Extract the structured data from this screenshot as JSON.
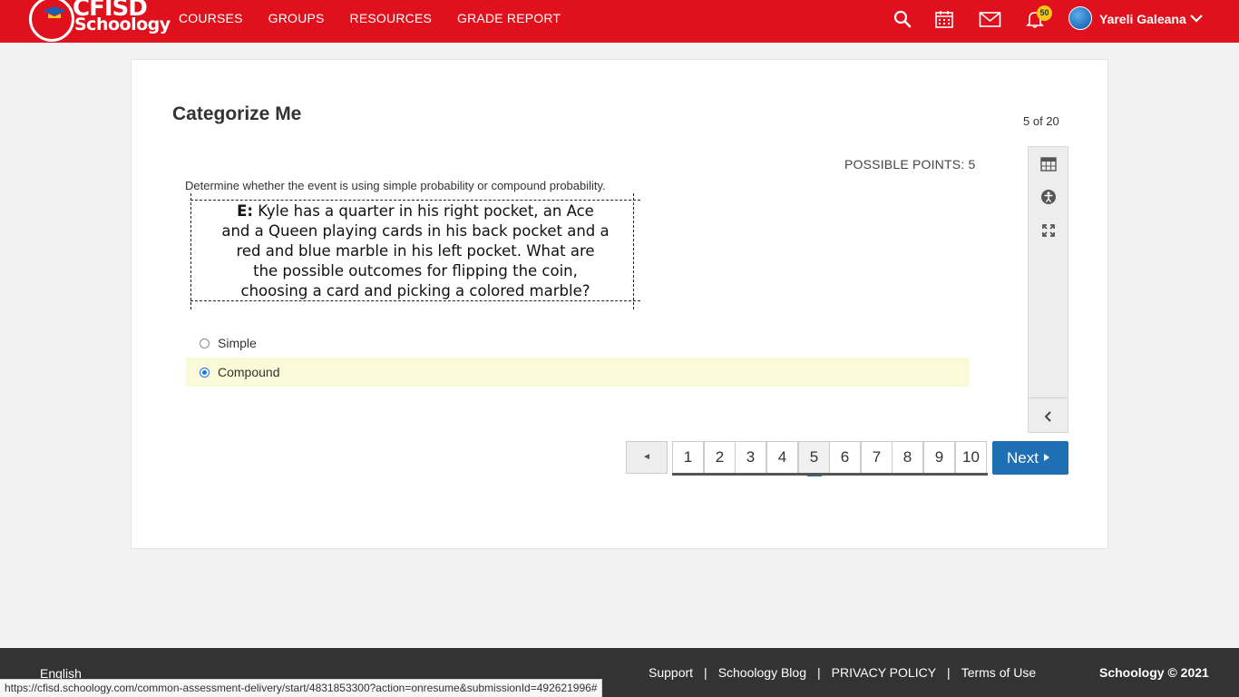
{
  "header": {
    "logo_top": "CFISD",
    "logo_bottom": "Schoology",
    "nav": [
      "COURSES",
      "GROUPS",
      "RESOURCES",
      "GRADE REPORT"
    ],
    "notification_count": "50",
    "user_name": "Yareli Galeana",
    "icons": [
      "search-icon",
      "calendar-icon",
      "mail-icon",
      "bell-icon",
      "chevron-down-icon"
    ]
  },
  "assessment": {
    "title": "Categorize Me",
    "counter": "5 of 20",
    "possible_points": "POSSIBLE POINTS: 5",
    "prompt": "Determine whether the event is using simple probability or compound probability.",
    "question_label": "E:",
    "question_lines": [
      "Kyle has a quarter in his right pocket, an Ace",
      "and a Queen playing cards in his back pocket and a",
      "red and blue marble in his left pocket.  What are",
      "the possible outcomes for flipping the coin,",
      "choosing a card and picking a colored marble?"
    ],
    "options": [
      {
        "label": "Simple",
        "selected": false
      },
      {
        "label": "Compound",
        "selected": true
      }
    ]
  },
  "tools": [
    "calculator-icon",
    "accessibility-icon",
    "fullscreen-icon",
    "collapse-left-icon"
  ],
  "pager": {
    "prev_symbol": "◄",
    "pages": [
      "1",
      "2",
      "3",
      "4",
      "5",
      "6",
      "7",
      "8",
      "9",
      "10"
    ],
    "current": "5",
    "next_label": "Next"
  },
  "footer": {
    "language": "English",
    "links": [
      "Support",
      "Schoology Blog",
      "PRIVACY POLICY",
      "Terms of Use"
    ],
    "separator": "|",
    "copyright": "Schoology © 2021"
  },
  "status_url": "https://cfisd.schoology.com/common-assessment-delivery/start/4831853300?action=onresume&submissionId=492621996#",
  "colors": {
    "brand_red": "#e0101c",
    "accent_blue": "#1f6fb5",
    "selected_bg": "#fbfad8",
    "badge_yellow": "#f3c814"
  }
}
